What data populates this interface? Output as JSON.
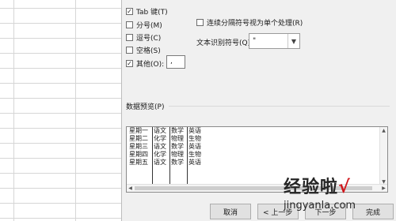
{
  "options": {
    "tab": {
      "label": "Tab 键(T)",
      "checked": true
    },
    "semicolon": {
      "label": "分号(M)",
      "checked": false
    },
    "comma": {
      "label": "逗号(C)",
      "checked": false
    },
    "space": {
      "label": "空格(S)",
      "checked": false
    },
    "other": {
      "label": "其他(O):",
      "checked": true,
      "value": ","
    }
  },
  "consecutive": {
    "label": "连续分隔符号视为单个处理(R)",
    "checked": false
  },
  "text_qualifier": {
    "label": "文本识别符号(Q):",
    "value": "\""
  },
  "preview": {
    "title": "数据预览(P)",
    "columns": [
      [
        "星期一",
        "星期二",
        "星期三",
        "星期四",
        "星期五"
      ],
      [
        "语文",
        "化学",
        "语文",
        "化学",
        "语文"
      ],
      [
        "数学",
        "物理",
        "数学",
        "物理",
        "数学"
      ],
      [
        "英语",
        "生物",
        "英语",
        "生物",
        "英语"
      ]
    ]
  },
  "buttons": {
    "cancel": "取消",
    "back": "< 上一步",
    "next": "下一步",
    "finish": "完成"
  },
  "watermark": {
    "main": "经验啦",
    "check": "√",
    "sub": "jingyanla.com"
  }
}
